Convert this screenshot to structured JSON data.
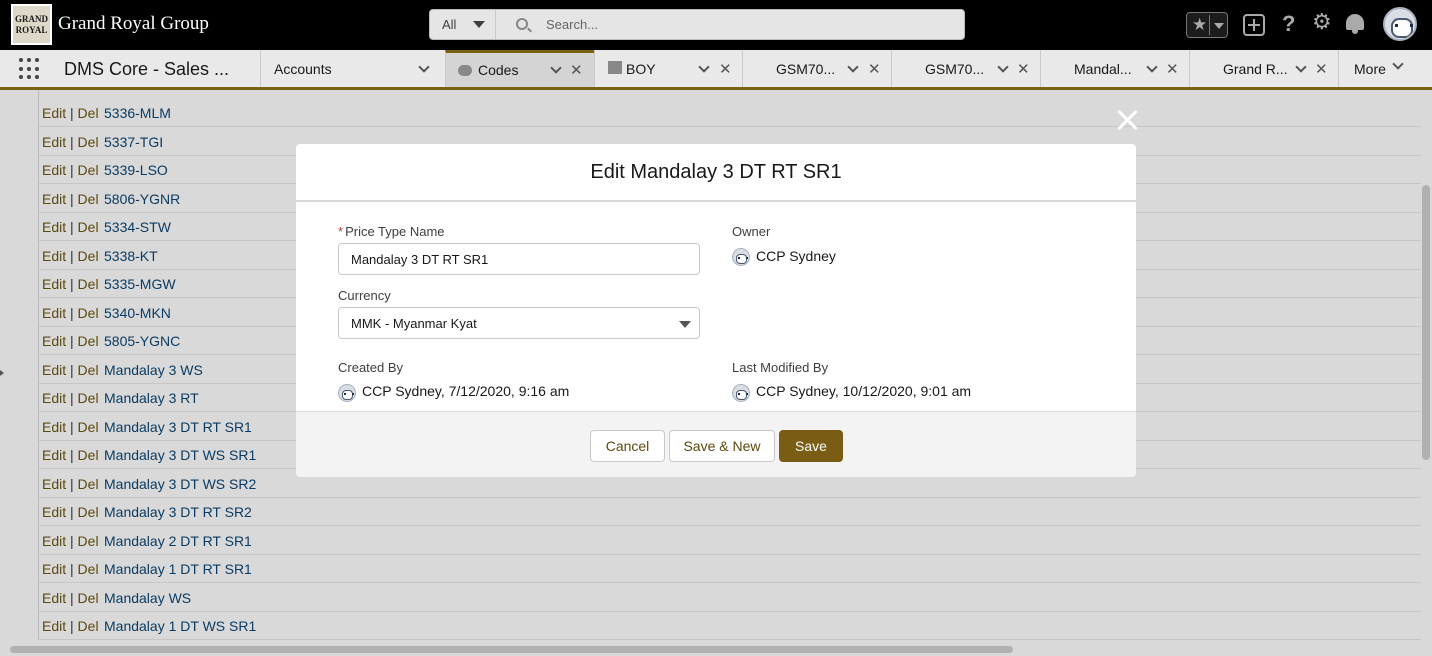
{
  "header": {
    "logo_line1": "GRAND",
    "logo_line2": "ROYAL",
    "brand": "Grand Royal Group",
    "search_scope": "All",
    "search_placeholder": "Search..."
  },
  "nav": {
    "app_name": "DMS Core - Sales ...",
    "tabs": [
      {
        "label": "Accounts"
      },
      {
        "label": "Codes"
      },
      {
        "label": "BOY"
      },
      {
        "label": "GSM70..."
      },
      {
        "label": "GSM70..."
      },
      {
        "label": "Mandal..."
      },
      {
        "label": "Grand R..."
      }
    ],
    "more_label": "More"
  },
  "list": {
    "edit_label": "Edit",
    "separator": "|",
    "del_label": "Del",
    "rows": [
      "5336-MLM",
      "5337-TGI",
      "5339-LSO",
      "5806-YGNR",
      "5334-STW",
      "5338-KT",
      "5335-MGW",
      "5340-MKN",
      "5805-YGNC",
      "Mandalay 3 WS",
      "Mandalay 3 RT",
      "Mandalay 3 DT RT SR1",
      "Mandalay 3 DT WS SR1",
      "Mandalay 3 DT WS SR2",
      "Mandalay 3 DT RT SR2",
      "Mandalay 2 DT RT SR1",
      "Mandalay 1 DT RT SR1",
      "Mandalay WS",
      "Mandalay 1 DT WS SR1"
    ]
  },
  "modal": {
    "title": "Edit Mandalay 3 DT RT SR1",
    "required_mark": "*",
    "price_type_label": "Price Type Name",
    "price_type_value": "Mandalay 3 DT RT SR1",
    "owner_label": "Owner",
    "owner_value": "CCP Sydney",
    "currency_label": "Currency",
    "currency_value": "MMK - Myanmar Kyat",
    "created_by_label": "Created By",
    "created_by_value": "CCP Sydney, 7/12/2020, 9:16 am",
    "last_modified_label": "Last Modified By",
    "last_modified_value": "CCP Sydney, 10/12/2020, 9:01 am",
    "cancel_label": "Cancel",
    "save_new_label": "Save & New",
    "save_label": "Save"
  },
  "colors": {
    "accent": "#7a5d14",
    "header_bg": "#000000",
    "link": "#0b3b62"
  }
}
